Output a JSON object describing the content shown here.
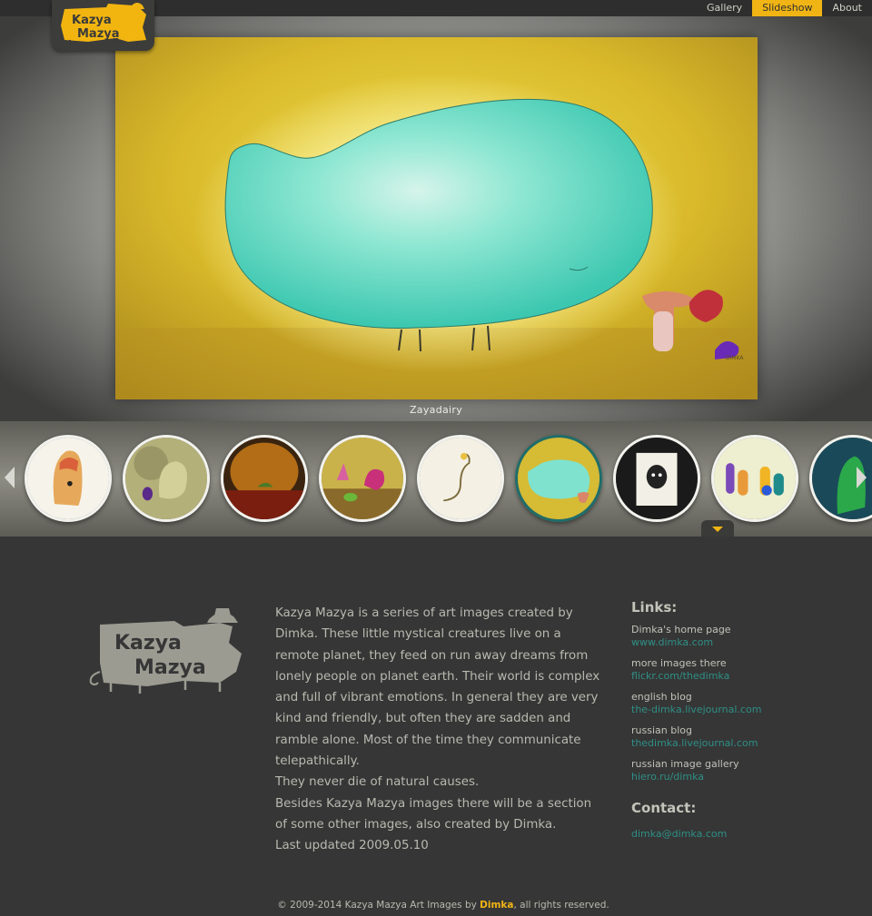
{
  "nav": {
    "items": [
      "Gallery",
      "Slideshow",
      "About"
    ],
    "active": "Slideshow"
  },
  "slideshow": {
    "caption": "Zayadairy",
    "thumbnail_count": 9,
    "active_index": 5
  },
  "about": {
    "paragraph_1": "Kazya Mazya is a series of art images created by Dimka. These little mystical creatures live on a remote planet, they feed on run away dreams from lonely people on planet earth. Their world is complex and full of vibrant emotions. In general they are very kind and friendly, but often they are sadden and ramble alone. Most of the time they communicate telepathically.",
    "paragraph_2": "They never die of natural causes.",
    "paragraph_3": "Besides Kazya Mazya images there will be a section of some other images, also created by Dimka.",
    "paragraph_4": "Last updated 2009.05.10"
  },
  "links": {
    "heading": "Links:",
    "items": [
      {
        "label": "Dimka's home page",
        "url_text": "www.dimka.com"
      },
      {
        "label": "more images there",
        "url_text": "flickr.com/thedimka"
      },
      {
        "label": "english blog",
        "url_text": "the-dimka.livejournal.com"
      },
      {
        "label": "russian blog",
        "url_text": "thedimka.livejournal.com"
      },
      {
        "label": "russian image gallery",
        "url_text": "hiero.ru/dimka"
      }
    ]
  },
  "contact": {
    "heading": "Contact:",
    "email": "dimka@dimka.com"
  },
  "footer": {
    "copyright_prefix": "© 2009-2014 Kazya Mazya Art Images by ",
    "author": "Dimka",
    "copyright_suffix": ", all rights reserved."
  },
  "colors": {
    "accent": "#f0b414",
    "link": "#2e8f86",
    "background": "#363636",
    "active_ring": "#1f6d69"
  },
  "logo": {
    "text_line_1": "Kazya",
    "text_line_2": "Mazya"
  }
}
